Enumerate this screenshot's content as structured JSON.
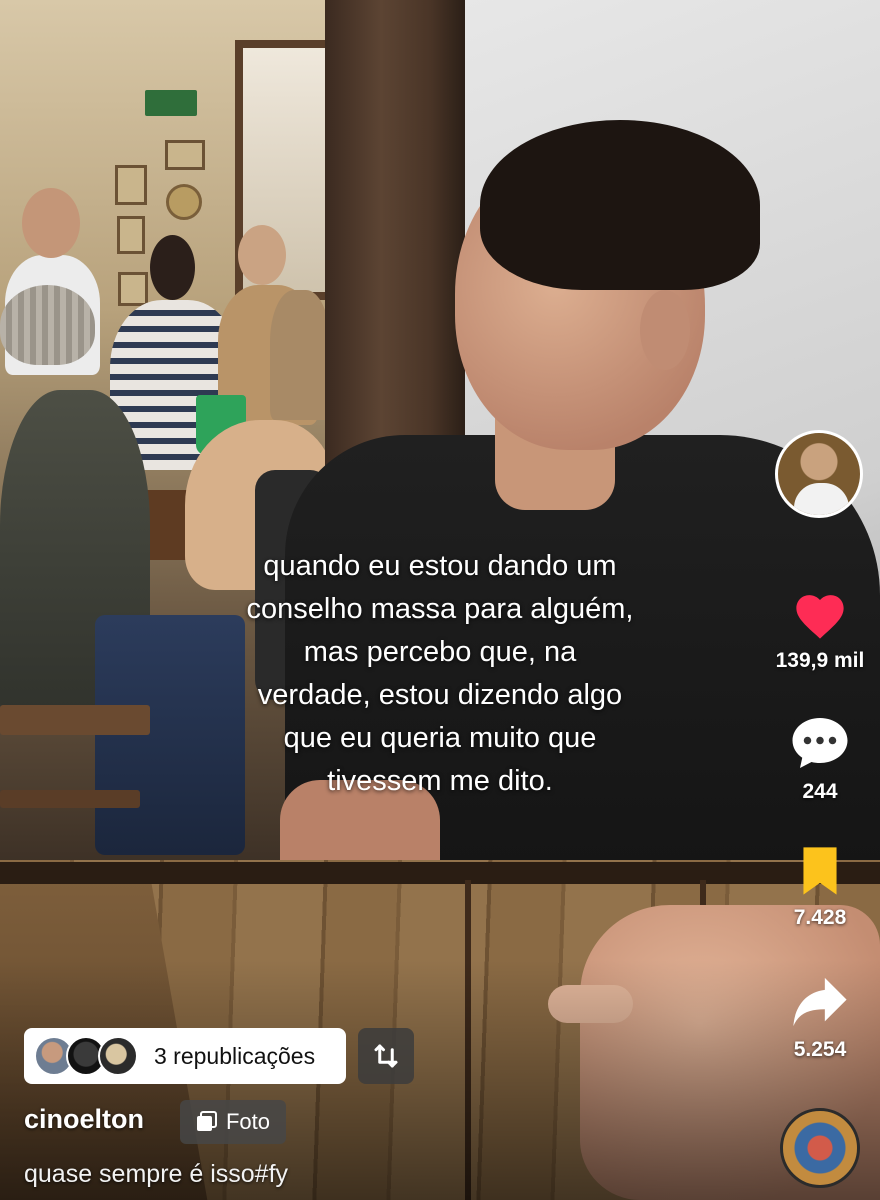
{
  "caption": {
    "lines": [
      "quando eu estou dando um",
      "conselho massa para alguém,",
      "mas percebo que, na",
      "verdade, estou dizendo algo",
      "que eu queria muito que",
      "tivessem me dito."
    ]
  },
  "actions": {
    "like_count": "139,9 mil",
    "comment_count": "244",
    "save_count": "7.428",
    "share_count": "5.254"
  },
  "republish": {
    "label": "3 republicações"
  },
  "author": {
    "username": "cinoelton",
    "badge_label": "Foto"
  },
  "description": "quase sempre é isso#fy",
  "colors": {
    "like": "#fe2c55",
    "save": "#fcc31c",
    "accent_white": "#ffffff"
  },
  "icons": [
    "avatar",
    "heart-icon",
    "comment-icon",
    "bookmark-icon",
    "share-icon",
    "repost-icon",
    "photo-icon",
    "music-disc"
  ]
}
